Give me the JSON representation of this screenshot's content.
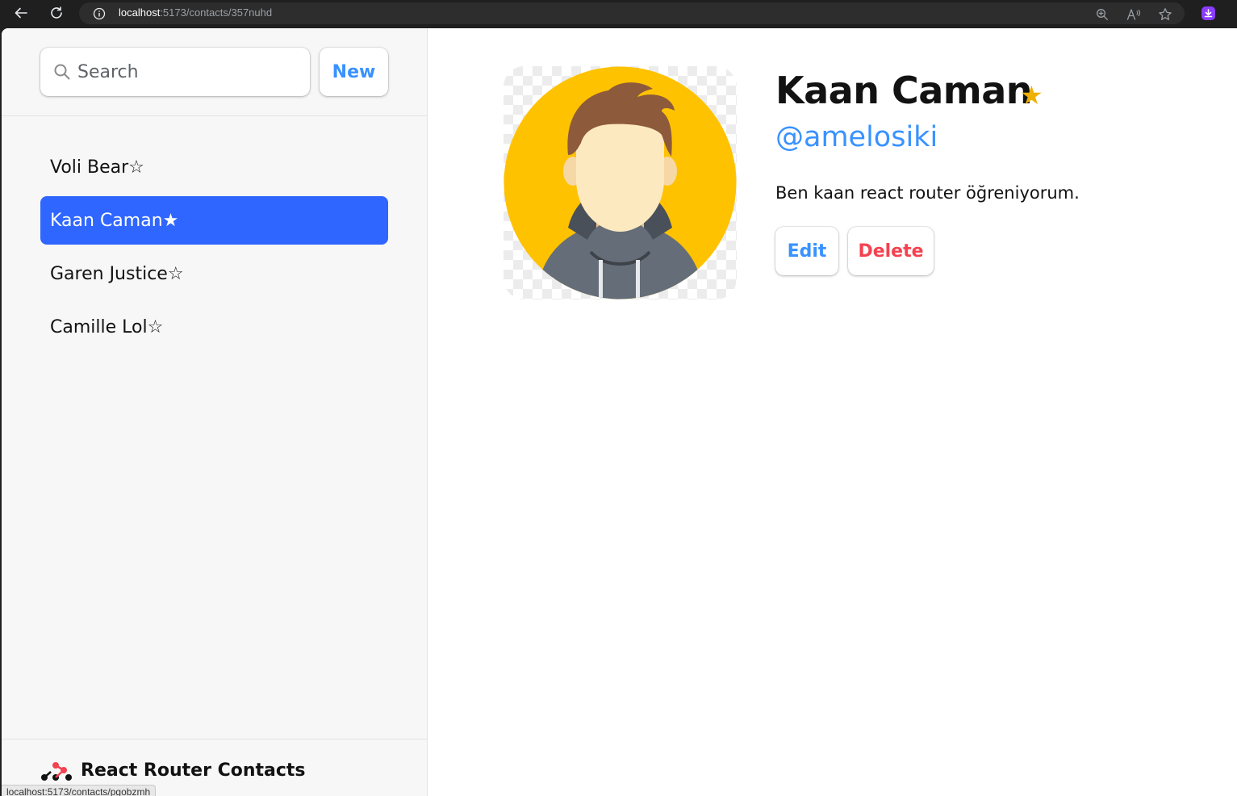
{
  "browser": {
    "url_host": "localhost",
    "url_path": ":5173/contacts/357nuhd",
    "icons": [
      "back-icon",
      "reload-icon",
      "info-icon",
      "zoom-icon",
      "read-aloud-icon",
      "favorite-star-icon",
      "extension-icon"
    ]
  },
  "sidebar": {
    "search": {
      "placeholder": "Search",
      "value": ""
    },
    "new_label": "New",
    "contacts": [
      {
        "label": "Voli Bear☆",
        "active": false
      },
      {
        "label": "Kaan Caman★",
        "active": true
      },
      {
        "label": "Garen Justice☆",
        "active": false
      },
      {
        "label": "Camille Lol☆",
        "active": false
      }
    ],
    "footer_title": "React Router Contacts"
  },
  "status_bar": {
    "url": "localhost:5173/contacts/pgobzmh"
  },
  "contact": {
    "name": "Kaan Caman",
    "favorite_glyph": "★",
    "twitter": "@amelosiki",
    "notes": "Ben kaan react router öğreniyorum.",
    "edit_label": "Edit",
    "delete_label": "Delete"
  },
  "colors": {
    "accent": "#3992ff",
    "active_item": "#2f66ff",
    "delete": "#f44250",
    "star": "#eeb004"
  }
}
